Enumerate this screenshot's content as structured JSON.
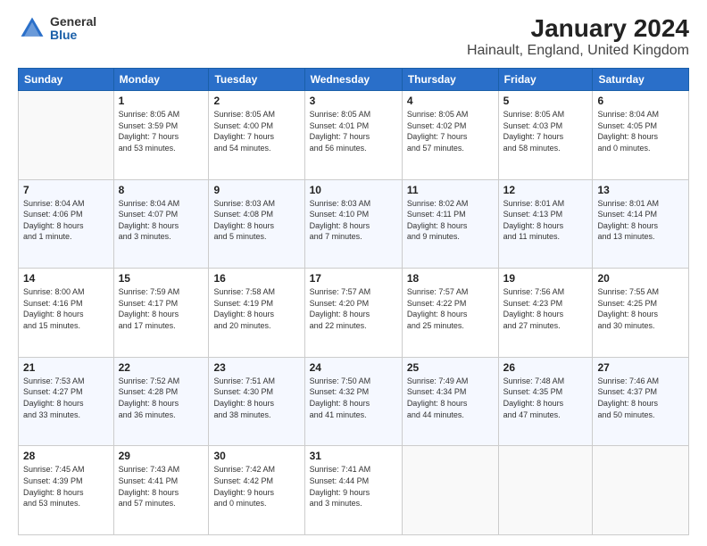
{
  "logo": {
    "general": "General",
    "blue": "Blue"
  },
  "title": "January 2024",
  "subtitle": "Hainault, England, United Kingdom",
  "days_of_week": [
    "Sunday",
    "Monday",
    "Tuesday",
    "Wednesday",
    "Thursday",
    "Friday",
    "Saturday"
  ],
  "weeks": [
    [
      {
        "day": "",
        "info": ""
      },
      {
        "day": "1",
        "info": "Sunrise: 8:05 AM\nSunset: 3:59 PM\nDaylight: 7 hours\nand 53 minutes."
      },
      {
        "day": "2",
        "info": "Sunrise: 8:05 AM\nSunset: 4:00 PM\nDaylight: 7 hours\nand 54 minutes."
      },
      {
        "day": "3",
        "info": "Sunrise: 8:05 AM\nSunset: 4:01 PM\nDaylight: 7 hours\nand 56 minutes."
      },
      {
        "day": "4",
        "info": "Sunrise: 8:05 AM\nSunset: 4:02 PM\nDaylight: 7 hours\nand 57 minutes."
      },
      {
        "day": "5",
        "info": "Sunrise: 8:05 AM\nSunset: 4:03 PM\nDaylight: 7 hours\nand 58 minutes."
      },
      {
        "day": "6",
        "info": "Sunrise: 8:04 AM\nSunset: 4:05 PM\nDaylight: 8 hours\nand 0 minutes."
      }
    ],
    [
      {
        "day": "7",
        "info": "Sunrise: 8:04 AM\nSunset: 4:06 PM\nDaylight: 8 hours\nand 1 minute."
      },
      {
        "day": "8",
        "info": "Sunrise: 8:04 AM\nSunset: 4:07 PM\nDaylight: 8 hours\nand 3 minutes."
      },
      {
        "day": "9",
        "info": "Sunrise: 8:03 AM\nSunset: 4:08 PM\nDaylight: 8 hours\nand 5 minutes."
      },
      {
        "day": "10",
        "info": "Sunrise: 8:03 AM\nSunset: 4:10 PM\nDaylight: 8 hours\nand 7 minutes."
      },
      {
        "day": "11",
        "info": "Sunrise: 8:02 AM\nSunset: 4:11 PM\nDaylight: 8 hours\nand 9 minutes."
      },
      {
        "day": "12",
        "info": "Sunrise: 8:01 AM\nSunset: 4:13 PM\nDaylight: 8 hours\nand 11 minutes."
      },
      {
        "day": "13",
        "info": "Sunrise: 8:01 AM\nSunset: 4:14 PM\nDaylight: 8 hours\nand 13 minutes."
      }
    ],
    [
      {
        "day": "14",
        "info": "Sunrise: 8:00 AM\nSunset: 4:16 PM\nDaylight: 8 hours\nand 15 minutes."
      },
      {
        "day": "15",
        "info": "Sunrise: 7:59 AM\nSunset: 4:17 PM\nDaylight: 8 hours\nand 17 minutes."
      },
      {
        "day": "16",
        "info": "Sunrise: 7:58 AM\nSunset: 4:19 PM\nDaylight: 8 hours\nand 20 minutes."
      },
      {
        "day": "17",
        "info": "Sunrise: 7:57 AM\nSunset: 4:20 PM\nDaylight: 8 hours\nand 22 minutes."
      },
      {
        "day": "18",
        "info": "Sunrise: 7:57 AM\nSunset: 4:22 PM\nDaylight: 8 hours\nand 25 minutes."
      },
      {
        "day": "19",
        "info": "Sunrise: 7:56 AM\nSunset: 4:23 PM\nDaylight: 8 hours\nand 27 minutes."
      },
      {
        "day": "20",
        "info": "Sunrise: 7:55 AM\nSunset: 4:25 PM\nDaylight: 8 hours\nand 30 minutes."
      }
    ],
    [
      {
        "day": "21",
        "info": "Sunrise: 7:53 AM\nSunset: 4:27 PM\nDaylight: 8 hours\nand 33 minutes."
      },
      {
        "day": "22",
        "info": "Sunrise: 7:52 AM\nSunset: 4:28 PM\nDaylight: 8 hours\nand 36 minutes."
      },
      {
        "day": "23",
        "info": "Sunrise: 7:51 AM\nSunset: 4:30 PM\nDaylight: 8 hours\nand 38 minutes."
      },
      {
        "day": "24",
        "info": "Sunrise: 7:50 AM\nSunset: 4:32 PM\nDaylight: 8 hours\nand 41 minutes."
      },
      {
        "day": "25",
        "info": "Sunrise: 7:49 AM\nSunset: 4:34 PM\nDaylight: 8 hours\nand 44 minutes."
      },
      {
        "day": "26",
        "info": "Sunrise: 7:48 AM\nSunset: 4:35 PM\nDaylight: 8 hours\nand 47 minutes."
      },
      {
        "day": "27",
        "info": "Sunrise: 7:46 AM\nSunset: 4:37 PM\nDaylight: 8 hours\nand 50 minutes."
      }
    ],
    [
      {
        "day": "28",
        "info": "Sunrise: 7:45 AM\nSunset: 4:39 PM\nDaylight: 8 hours\nand 53 minutes."
      },
      {
        "day": "29",
        "info": "Sunrise: 7:43 AM\nSunset: 4:41 PM\nDaylight: 8 hours\nand 57 minutes."
      },
      {
        "day": "30",
        "info": "Sunrise: 7:42 AM\nSunset: 4:42 PM\nDaylight: 9 hours\nand 0 minutes."
      },
      {
        "day": "31",
        "info": "Sunrise: 7:41 AM\nSunset: 4:44 PM\nDaylight: 9 hours\nand 3 minutes."
      },
      {
        "day": "",
        "info": ""
      },
      {
        "day": "",
        "info": ""
      },
      {
        "day": "",
        "info": ""
      }
    ]
  ]
}
